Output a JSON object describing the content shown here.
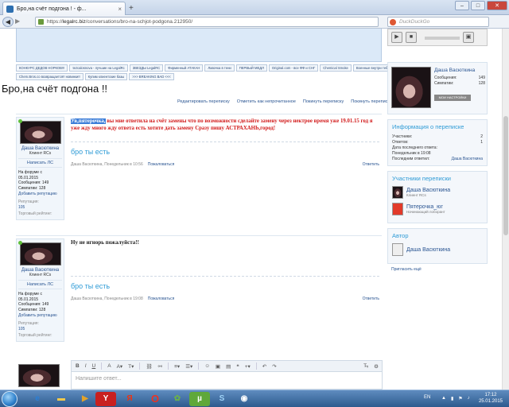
{
  "browser": {
    "tab_title": "Бро,на счёт подгона ! - ф...",
    "url_host": "legalrc.biz",
    "url_path": "/conversations/bro-na-schjot-podgona.212950/",
    "url_prefix": "https://",
    "search_placeholder": "DuckDuckGo",
    "new_tab": "+"
  },
  "nav_links": {
    "row1": [
      "КОНКУРС ДЕДОВ НОРКОВ!!!",
      "tezcalosnova - лучшие на LegalRc",
      "ЗВЕЗДЫ LegalRC",
      "Фирменный АТАКАН",
      "Лавочка в тени",
      "ПЕРВЫЙ МЕДЛ",
      "Original.com - все ФФ и СНГ",
      "Chemical Smoke",
      "Военные внутри тебя"
    ],
    "row2": [
      "Chem.Bros.co возвращается!! новинки!!",
      "Купим клиентские базы",
      ">>> BREAKING BAD <<<"
    ]
  },
  "page": {
    "title": "Бро,на счёт подгона !!",
    "actions": [
      "Редактировать переписку",
      "Отметить как непрочитанное",
      "Покинуть переписку",
      "Покинуть переписку"
    ]
  },
  "user": {
    "name": "Даша Васюткина",
    "role": "Клиент RCs",
    "write_pm": "Написать ЛС",
    "on_forum_label": "На форуме с",
    "on_forum": "05.01.2015",
    "messages_label": "Сообщения:",
    "messages": "149",
    "likes_label": "Симпатии:",
    "likes": "128",
    "add_rep": "Добавить репутацию",
    "reputation_label": "Репутация:",
    "reputation": "105",
    "trade_label": "Торговый рейтинг:"
  },
  "posts": [
    {
      "highlight": "Ув,пятерочка,",
      "text": " вы мне ответила на счёт замены что по возможности сделайте замену через нектрое время уже 19.01.15 год я уже жду много жду ответа есть хотите дать замену Сразу пишу АСТРАХАНЬ,город!",
      "signature": "бро ты есть",
      "meta": "Даша Васюткина, Понедельник в 10:56",
      "report": "Пожаловаться",
      "reply": "Ответить"
    },
    {
      "text": "Ну не игнорь пожалуйста!!",
      "signature": "бро ты есть",
      "meta": "Даша Васюткина, Понедельник в 19:08",
      "report": "Пожаловаться",
      "reply": "Ответить"
    }
  ],
  "editor": {
    "placeholder": "Напишите ответ..."
  },
  "sidebar": {
    "profile": {
      "name": "Даша Васюткина",
      "messages_label": "Сообщения:",
      "messages": "149",
      "likes_label": "Симпатии:",
      "likes": "128",
      "settings": "МОИ НАСТРОЙКИ"
    },
    "info": {
      "title": "Информация о переписке",
      "participants_label": "Участники:",
      "participants": "2",
      "replies_label": "Ответов:",
      "replies": "1",
      "last_date_label": "Дата последнего ответа:",
      "last_date": "Понедельник в 19:08",
      "last_replier_label": "Последним ответил:",
      "last_replier": "Даша Васюткина"
    },
    "participants": {
      "title": "Участники переписки",
      "list": [
        {
          "name": "Даша Васюткина",
          "role": "Клиент RCs"
        },
        {
          "name": "Пятерочка_юг",
          "role": "Начинающий лоборант"
        }
      ]
    },
    "author": {
      "title": "Автор",
      "name": "Даша Васюткина"
    },
    "invite": "Пригласить ещё"
  },
  "taskbar": {
    "lang": "EN",
    "time": "17:12",
    "date": "25.01.2015",
    "yandex_letter": "Я"
  },
  "colors": {
    "link": "#2a5592",
    "accent": "#2e9bd6",
    "message_red": "#d21b1b",
    "highlight": "#3b7dd8"
  }
}
